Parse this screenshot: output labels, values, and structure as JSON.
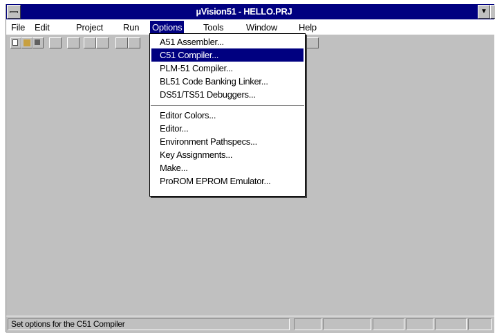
{
  "window": {
    "title": "µVision51 - HELLO.PRJ"
  },
  "menubar": {
    "items": [
      "File",
      "Edit",
      "Project",
      "Run",
      "Options",
      "Tools",
      "Window",
      "Help"
    ],
    "active": "Options"
  },
  "options_menu": {
    "group1": [
      "A51 Assembler...",
      "C51 Compiler...",
      "PLM-51 Compiler...",
      "BL51 Code Banking Linker...",
      "DS51/TS51 Debuggers..."
    ],
    "group2": [
      "Editor Colors...",
      "Editor...",
      "Environment Pathspecs...",
      "Key Assignments...",
      "Make...",
      "ProROM EPROM Emulator..."
    ],
    "highlighted": "C51 Compiler..."
  },
  "status": {
    "text": "Set options for the C51 Compiler"
  },
  "colors": {
    "titlebar": "#000080",
    "face": "#c0c0c0",
    "highlight": "#000080"
  },
  "icons": [
    "system-menu-icon",
    "new-file-icon",
    "open-folder-icon",
    "save-icon",
    "minimize-icon"
  ]
}
